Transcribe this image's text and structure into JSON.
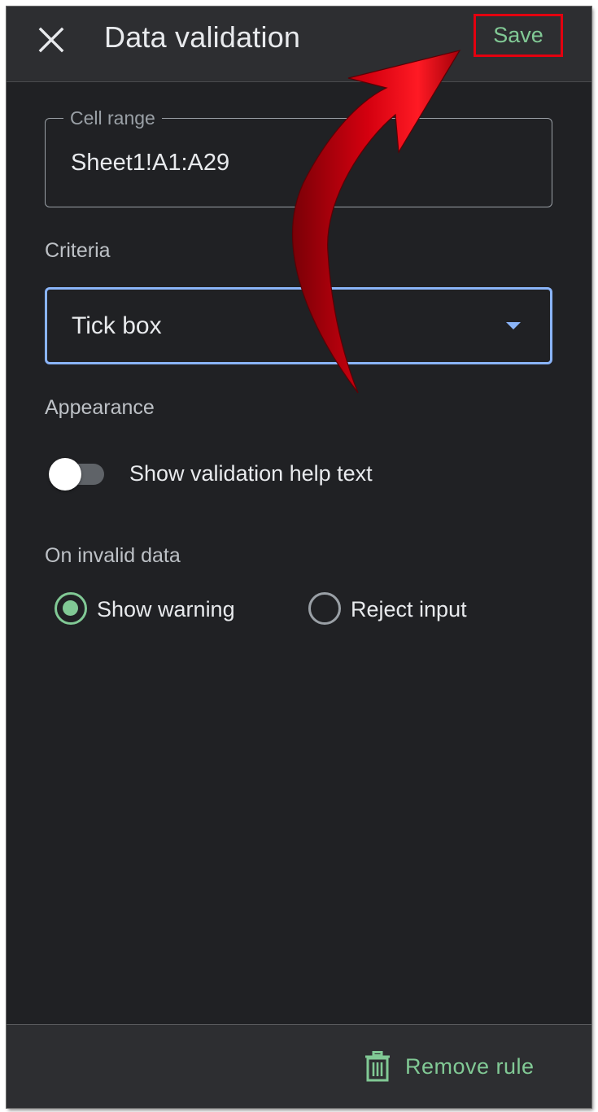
{
  "header": {
    "title": "Data validation",
    "close_icon": "close-icon",
    "save_label": "Save"
  },
  "cell_range": {
    "label": "Cell range",
    "value": "Sheet1!A1:A29"
  },
  "criteria": {
    "label": "Criteria",
    "selected": "Tick box",
    "dropdown_icon": "caret-down-icon"
  },
  "appearance": {
    "label": "Appearance",
    "toggle_label": "Show validation help text",
    "toggle_on": false
  },
  "invalid_data": {
    "label": "On invalid data",
    "options": [
      {
        "label": "Show warning",
        "selected": true
      },
      {
        "label": "Reject input",
        "selected": false
      }
    ]
  },
  "footer": {
    "remove_label": "Remove rule",
    "remove_icon": "trash-icon"
  },
  "annotation": {
    "type": "red-arrow",
    "target": "save-button",
    "color": "#e3000f"
  },
  "colors": {
    "background": "#202124",
    "bar": "#2d2e31",
    "accent_green": "#81c995",
    "accent_blue": "#8ab4f8",
    "highlight_red": "#e3000f"
  }
}
